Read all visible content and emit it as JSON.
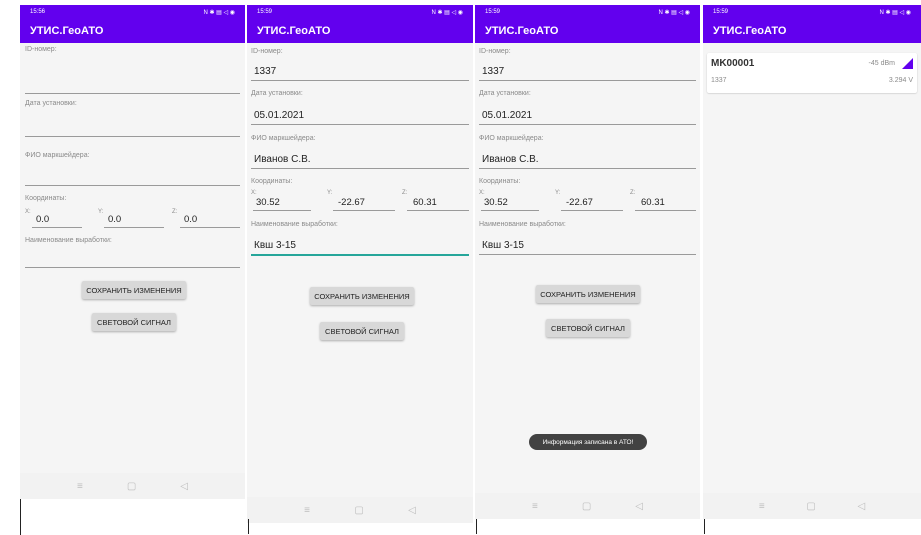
{
  "status": {
    "time1": "15:56",
    "time2": "15:59",
    "time3": "15:59",
    "time4": "15:59",
    "icons_left": "• •",
    "icons_right": "N ✱ ▤ ◁ ◉"
  },
  "app": {
    "title": "УТИС.ГеоАТО"
  },
  "form": {
    "id_label": "ID-номер:",
    "date_label": "Дата установки:",
    "fio_label": "ФИО маркшейдера:",
    "coords_label": "Координаты:",
    "x_label": "X:",
    "y_label": "Y:",
    "z_label": "Z:",
    "work_label": "Наименование выработки:",
    "save_label": "СОХРАНИТЬ ИЗМЕНЕНИЯ",
    "signal_label": "СВЕТОВОЙ СИГНАЛ"
  },
  "screen1": {
    "x": "0.0",
    "y": "0.0",
    "z": "0.0"
  },
  "screen2": {
    "id": "1337",
    "date": "05.01.2021",
    "fio": "Иванов С.В.",
    "x": "30.52",
    "y": "-22.67",
    "z": "60.31",
    "work": "Квш 3-15"
  },
  "screen3": {
    "id": "1337",
    "date": "05.01.2021",
    "fio": "Иванов С.В.",
    "x": "30.52",
    "y": "-22.67",
    "z": "60.31",
    "work": "Квш 3-15",
    "toast": "Информация записана в АТО!"
  },
  "screen4": {
    "device_name": "MK00001",
    "device_id": "1337",
    "rssi": "-45 dBm",
    "voltage": "3.294 V"
  },
  "nav": {
    "menu": "≡",
    "home": "▢",
    "back": "◁"
  }
}
